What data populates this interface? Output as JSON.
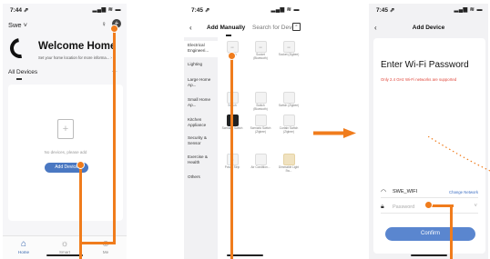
{
  "colors": {
    "accent": "#f07c1c",
    "primary_blue": "#4a78c2",
    "warning_red": "#e0463a"
  },
  "phone1": {
    "status_time": "7:44 ⇗",
    "status_icons": "▂▄▆ ≋ ▬",
    "home_selector": "Swe ˅",
    "welcome_title": "Welcome Home",
    "welcome_subtitle": "Set your home location for more informa...  ›",
    "all_devices": "All Devices",
    "more_icon": "···",
    "empty_message": "No devices, please add",
    "add_device_button": "Add Device",
    "tabs": [
      {
        "label": "Home",
        "icon": "home-icon"
      },
      {
        "label": "Smart",
        "icon": "sun-icon"
      },
      {
        "label": "Me",
        "icon": "profile-icon"
      }
    ]
  },
  "phone2": {
    "status_time": "7:45 ⇗",
    "tab_add_manually": "Add Manually",
    "tab_search": "Search for Devi",
    "categories": [
      "Electrical Engineeri...",
      "Lighting",
      "Large Home Ap...",
      "Small Home Ap...",
      "Kitchen Appliance",
      "Security & Sensor",
      "Exercise & Health",
      "Others"
    ],
    "products": [
      "Switch",
      "Socket (Bluetooth)",
      "Socket (Zigbee)",
      "",
      "",
      "",
      "Switch",
      "Switch (Bluetooth)",
      "Switch (Zigbee)",
      "Scenario Switch",
      "Scenario Switch (Zigbee)",
      "Curtain Switch (Zigbee)",
      "Power Strip",
      "Air Condition...",
      "Dimmable Light Sw..."
    ]
  },
  "phone3": {
    "status_time": "7:45 ⇗",
    "header_title": "Add Device",
    "title": "Enter Wi-Fi Password",
    "warning": "Only 2.4 GHz Wi-Fi networks are supported",
    "wifi_name": "SWE_WIFI",
    "change_network": "Change Network",
    "password_placeholder": "Password",
    "confirm_button": "Confirm"
  }
}
